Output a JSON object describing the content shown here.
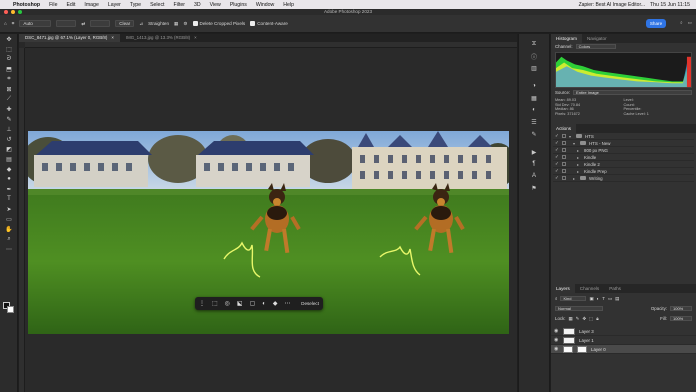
{
  "menubar": {
    "app": "Photoshop",
    "items": [
      "File",
      "Edit",
      "Image",
      "Layer",
      "Type",
      "Select",
      "Filter",
      "3D",
      "View",
      "Plugins",
      "Window",
      "Help"
    ],
    "zapier": "Zapier: Best AI Image Editor...",
    "time": "11:15",
    "date": "Thu 15 Jun 11:15"
  },
  "window": {
    "title": "Adobe Photoshop 2023"
  },
  "options": {
    "mode": "Auto",
    "clear": "Clear",
    "straighten": "Straighten",
    "delete_cropped": "Delete Cropped Pixels",
    "content_aware": "Content-Aware",
    "share": "Share"
  },
  "tabs": [
    {
      "label": "DSC_8471.jpg @ 67.1% (Layer 0, RGB/8)",
      "close": "×"
    },
    {
      "label": "IMG_1413.jpg @ 13.3% (RGB/8)",
      "close": "×"
    }
  ],
  "ctxbar": {
    "deselect": "Deselect"
  },
  "histogram": {
    "tabs": [
      "Histogram",
      "Navigator"
    ],
    "channel_label": "Channel:",
    "channel": "Colors",
    "source_label": "Source:",
    "source": "Entire Image",
    "stats_left": [
      "Mean: 89.03",
      "Std Dev: 70.84",
      "Median: 86",
      "Pixels: 371672"
    ],
    "stats_right": [
      "Level:",
      "Count:",
      "Percentile:",
      "Cache Level: 1"
    ]
  },
  "actions": {
    "title": "Actions",
    "items": [
      {
        "label": "HTS",
        "depth": 0,
        "type": "folder"
      },
      {
        "label": "HTS - New",
        "depth": 1,
        "type": "folder"
      },
      {
        "label": "800 px PNG",
        "depth": 2,
        "type": "action"
      },
      {
        "label": "Kindle",
        "depth": 2,
        "type": "action"
      },
      {
        "label": "Kindle 2",
        "depth": 2,
        "type": "action"
      },
      {
        "label": "Kindle Prep",
        "depth": 2,
        "type": "action"
      },
      {
        "label": "Writing",
        "depth": 1,
        "type": "folder"
      }
    ]
  },
  "layers": {
    "tabs": [
      "Layers",
      "Channels",
      "Paths"
    ],
    "kind": "Kind",
    "blend": "Normal",
    "opacity_label": "Opacity:",
    "opacity": "100%",
    "lock_label": "Lock:",
    "fill_label": "Fill:",
    "fill": "100%",
    "items": [
      {
        "name": "Layer 3",
        "active": false
      },
      {
        "name": "Layer 1",
        "active": false
      },
      {
        "name": "Layer 0",
        "active": true
      }
    ]
  }
}
